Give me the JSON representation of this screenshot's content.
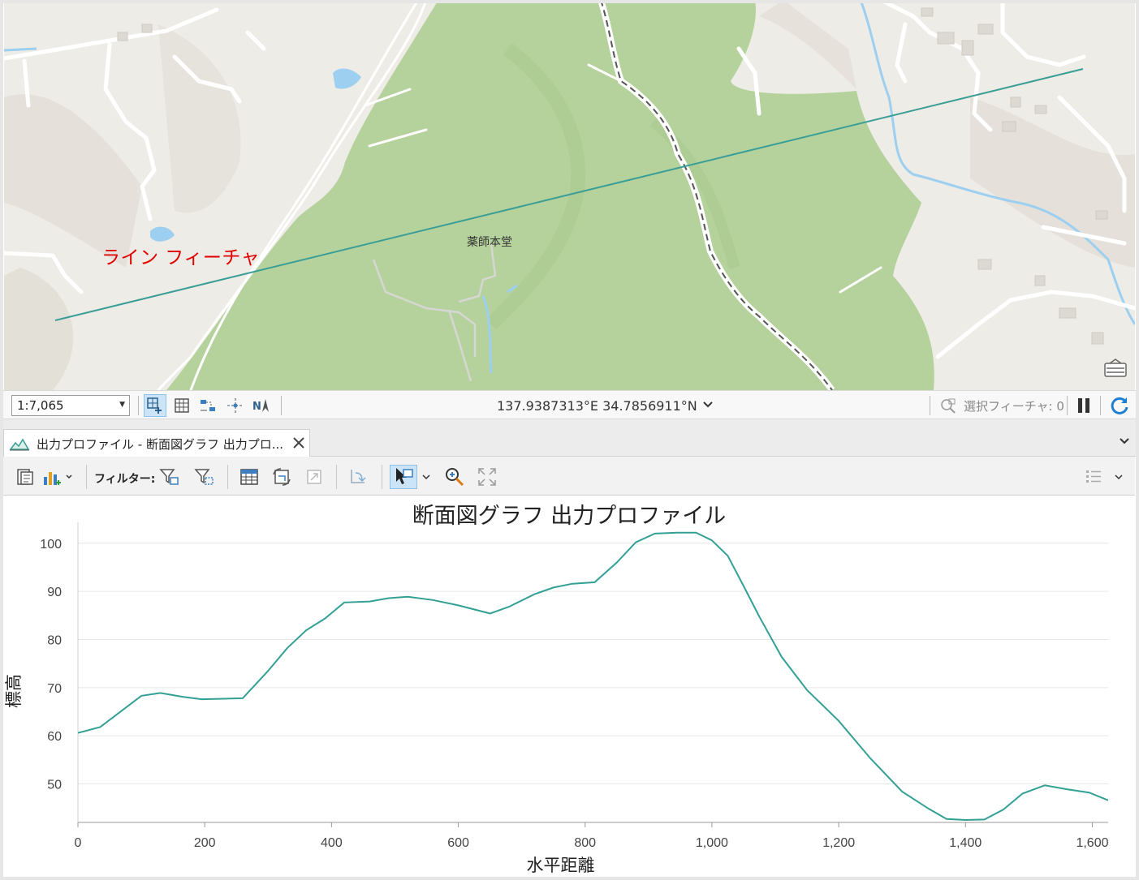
{
  "map": {
    "line_feature_label": "ライン フィーチャ",
    "place_label": "薬師本堂"
  },
  "map_bar": {
    "scale": "1:7,065",
    "coordinates": "137.9387313°E 34.7856911°N",
    "selected_features": "選択フィーチャ: 0"
  },
  "pane": {
    "tab_label": "出力プロファイル - 断面図グラフ 出力プロ...",
    "filter_label": "フィルター:"
  },
  "colors": {
    "line": "#3a9e96",
    "profile_line": "#33a095",
    "forest": "#b5d29c",
    "water": "#9ccff0",
    "red_label": "#e00000"
  },
  "chart_data": {
    "type": "line",
    "title": "断面図グラフ 出力プロファイル",
    "xlabel": "水平距離",
    "ylabel": "標高",
    "xlim": [
      0,
      1625
    ],
    "ylim": [
      42,
      100
    ],
    "xticks": [
      "0",
      "200",
      "400",
      "600",
      "800",
      "1,000",
      "1,200",
      "1,400",
      "1,600"
    ],
    "yticks": [
      "50",
      "60",
      "70",
      "80",
      "90",
      "100"
    ],
    "grid": true,
    "series": [
      {
        "x": [
          0,
          35,
          65,
          100,
          130,
          165,
          195,
          230,
          260,
          300,
          330,
          360,
          390,
          420,
          460,
          490,
          520,
          560,
          600,
          650,
          680,
          720,
          750,
          780,
          815,
          850,
          880,
          910,
          945,
          975,
          1000,
          1025,
          1050,
          1075,
          1110,
          1150,
          1200,
          1250,
          1300,
          1340,
          1370,
          1400,
          1430,
          1460,
          1490,
          1525,
          1560,
          1595,
          1625
        ],
        "y": [
          60.6,
          61.8,
          64.8,
          68.3,
          68.9,
          68.1,
          67.6,
          67.7,
          67.8,
          73.5,
          78.2,
          81.9,
          84.4,
          87.7,
          87.9,
          88.6,
          88.9,
          88.2,
          87.1,
          85.4,
          86.8,
          89.4,
          90.8,
          91.6,
          91.9,
          96,
          100.2,
          102,
          102.2,
          102.2,
          100.6,
          97.4,
          91.1,
          84.7,
          76.4,
          69.5,
          63.1,
          55.3,
          48.4,
          45,
          42.7,
          42.5,
          42.6,
          44.7,
          48,
          49.7,
          48.9,
          48.2,
          46.6
        ]
      }
    ]
  }
}
